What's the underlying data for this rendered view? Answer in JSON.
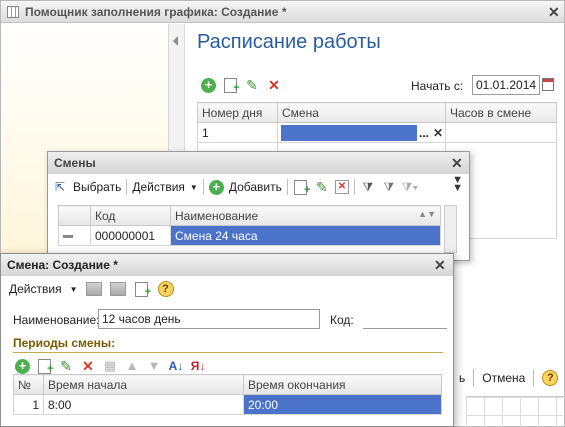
{
  "main_window": {
    "title": "Помощник заполнения графика: Создание *",
    "heading": "Расписание работы",
    "start_label": "Начать с:",
    "start_date": "01.01.2014",
    "table": {
      "headers": [
        "Номер дня",
        "Смена",
        "Часов в смене"
      ],
      "rows": [
        {
          "day": "1",
          "shift": "",
          "hours": ""
        }
      ]
    },
    "buttons": {
      "ok_partial": "ь",
      "cancel": "Отмена",
      "help": "?"
    }
  },
  "shifts_window": {
    "title": "Смены",
    "toolbar": {
      "select": "Выбрать",
      "actions": "Действия",
      "add": "Добавить"
    },
    "table": {
      "headers": [
        "Код",
        "Наименование"
      ],
      "rows": [
        {
          "code": "000000001",
          "name": "Смена 24 часа"
        }
      ]
    }
  },
  "create_window": {
    "title": "Смена: Создание *",
    "toolbar": {
      "actions": "Действия",
      "help": "?"
    },
    "name_label": "Наименование:",
    "name_value": "12 часов день",
    "code_label": "Код:",
    "code_value": "",
    "periods_label": "Периоды смены:",
    "table": {
      "headers": [
        "№",
        "Время начала",
        "Время окончания"
      ],
      "rows": [
        {
          "n": "1",
          "start": "8:00",
          "end": "20:00"
        }
      ]
    }
  },
  "colors": {
    "selection": "#4a73c9",
    "heading": "#2a5d9f",
    "section": "#7a5b00"
  }
}
